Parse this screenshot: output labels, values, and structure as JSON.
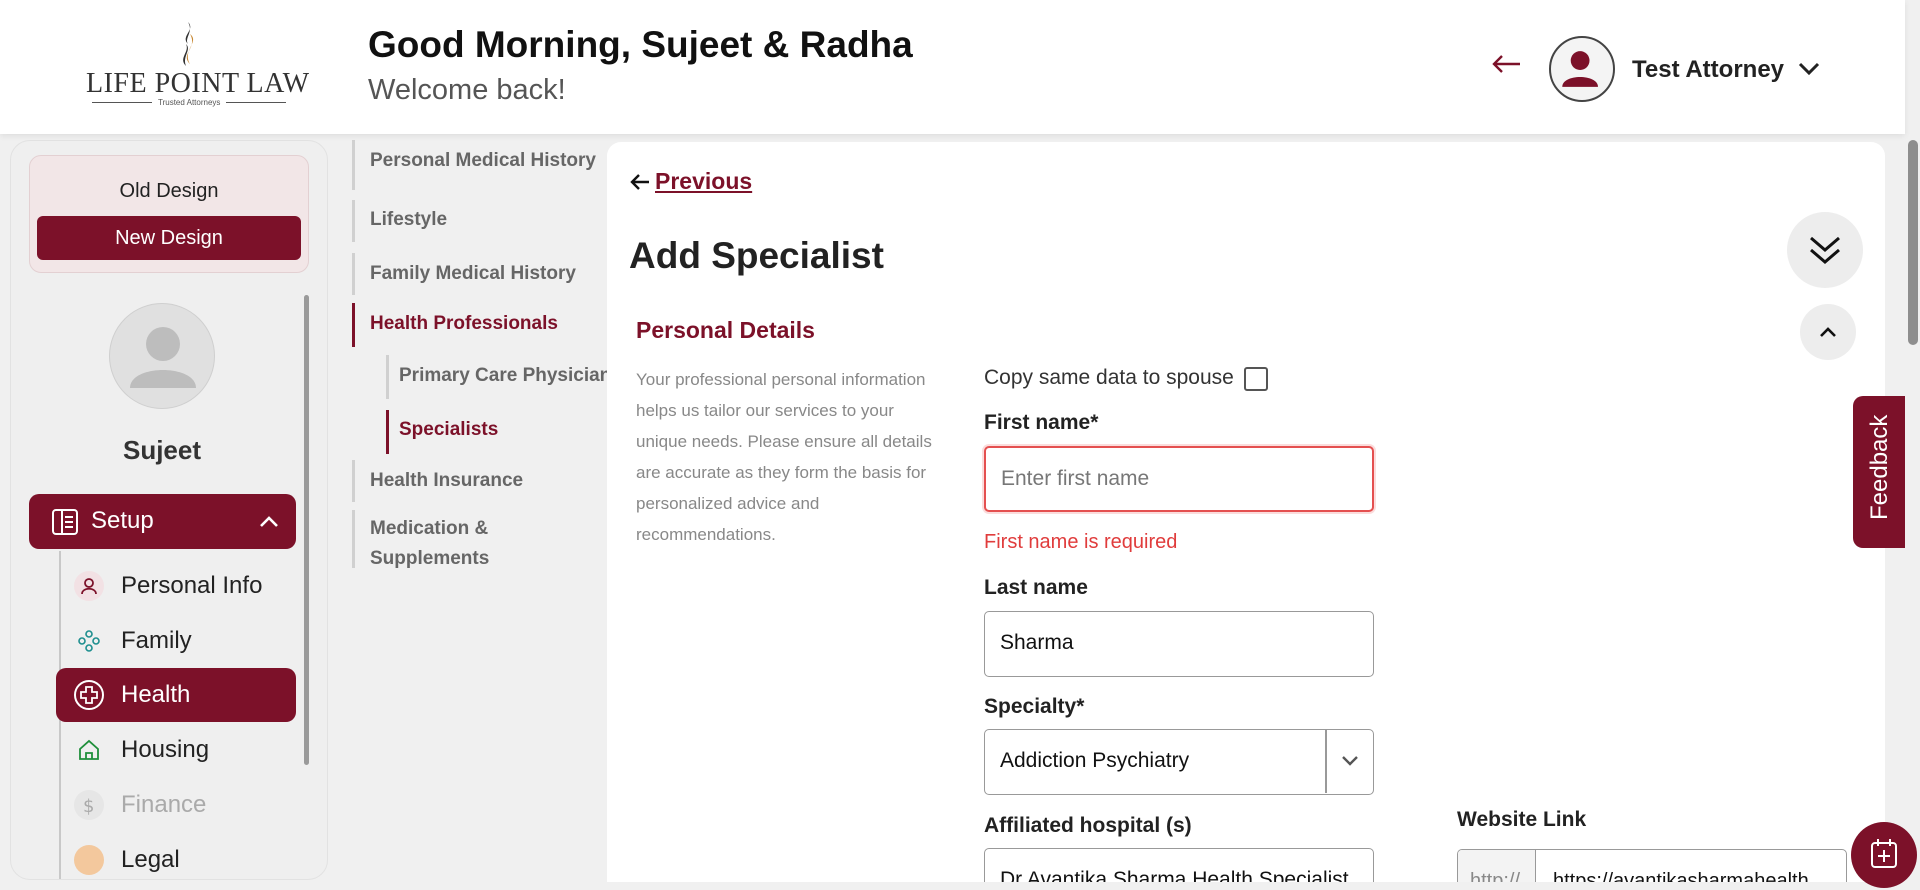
{
  "header": {
    "logo_text": "LIFE POINT LAW",
    "logo_tagline": "Trusted Attorneys",
    "greeting": "Good Morning, Sujeet & Radha",
    "welcome": "Welcome back!",
    "user_name": "Test Attorney"
  },
  "sidebar": {
    "old_design_label": "Old Design",
    "new_design_label": "New Design",
    "profile_name": "Sujeet",
    "setup_label": "Setup",
    "items": [
      {
        "label": "Personal Info",
        "icon": "person-icon"
      },
      {
        "label": "Family",
        "icon": "family-icon"
      },
      {
        "label": "Health",
        "icon": "health-cross-icon"
      },
      {
        "label": "Housing",
        "icon": "house-icon"
      },
      {
        "label": "Finance",
        "icon": "dollar-icon"
      },
      {
        "label": "Legal",
        "icon": "legal-icon"
      }
    ]
  },
  "steps": {
    "personal_medical_history": "Personal Medical History",
    "lifestyle": "Lifestyle",
    "family_medical_history": "Family Medical History",
    "health_professionals": "Health Professionals",
    "primary_care_physician": "Primary Care Physician",
    "specialists": "Specialists",
    "health_insurance": "Health Insurance",
    "medication_line1": "Medication &",
    "medication_line2": "Supplements"
  },
  "main": {
    "previous_label": "Previous",
    "title": "Add Specialist",
    "section_title": "Personal Details",
    "section_description": "Your professional personal information helps us tailor our services to your unique needs. Please ensure all details are accurate as they form the basis for personalized advice and recommendations.",
    "copy_spouse_label": "Copy same data to spouse",
    "first_name_label": "First name*",
    "first_name_placeholder": "Enter first name",
    "first_name_error": "First name is required",
    "last_name_label": "Last name",
    "last_name_value": "Sharma",
    "specialty_label": "Specialty*",
    "specialty_value": "Addiction Psychiatry",
    "affiliated_label": "Affiliated hospital (s)",
    "affiliated_value": "Dr.Avantika Sharma Health Specialist",
    "website_label": "Website Link",
    "website_prefix": "http://",
    "website_value": "https://avantikasharmahealth"
  },
  "feedback_label": "Feedback",
  "colors": {
    "brand": "#7c1129",
    "error": "#e03c3c"
  }
}
